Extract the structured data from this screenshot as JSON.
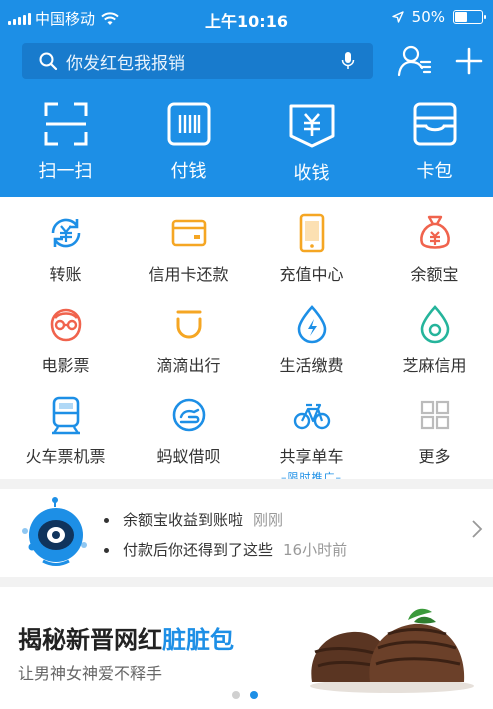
{
  "status_bar": {
    "carrier": "中国移动",
    "time": "上午10:16",
    "battery_text": "50%",
    "battery_level": 0.5
  },
  "search": {
    "placeholder": "你发红包我报销"
  },
  "header_icons": [
    "contacts-icon",
    "plus-icon"
  ],
  "quick_actions": [
    {
      "label": "扫一扫",
      "icon": "scan-icon"
    },
    {
      "label": "付钱",
      "icon": "barcode-icon"
    },
    {
      "label": "收钱",
      "icon": "receive-icon"
    },
    {
      "label": "卡包",
      "icon": "card-wallet-icon"
    }
  ],
  "services": [
    {
      "label": "转账",
      "icon": "transfer-icon",
      "color": "#1d8fe6"
    },
    {
      "label": "信用卡还款",
      "icon": "credit-card-icon",
      "color": "#f5a623"
    },
    {
      "label": "充值中心",
      "icon": "phone-topup-icon",
      "color": "#f5a623"
    },
    {
      "label": "余额宝",
      "icon": "money-bag-icon",
      "color": "#f0634d"
    },
    {
      "label": "电影票",
      "icon": "movie-icon",
      "color": "#f0634d"
    },
    {
      "label": "滴滴出行",
      "icon": "didi-icon",
      "color": "#f5a623"
    },
    {
      "label": "生活缴费",
      "icon": "utility-icon",
      "color": "#1d8fe6"
    },
    {
      "label": "芝麻信用",
      "icon": "sesame-credit-icon",
      "color": "#25b49b"
    },
    {
      "label": "火车票机票",
      "icon": "train-icon",
      "color": "#1d8fe6"
    },
    {
      "label": "蚂蚁借呗",
      "icon": "ant-loan-icon",
      "color": "#1d8fe6"
    },
    {
      "label": "共享单车",
      "icon": "bike-icon",
      "color": "#1d8fe6",
      "promo": "限时推广"
    },
    {
      "label": "更多",
      "icon": "more-grid-icon",
      "color": "#bbbbbb"
    }
  ],
  "notifications": [
    {
      "text": "余额宝收益到账啦",
      "time": "刚刚"
    },
    {
      "text": "付款后你还得到了这些",
      "time": "16小时前"
    }
  ],
  "banner": {
    "title_main": "揭秘新晋网红",
    "title_highlight": "脏脏包",
    "subtitle": "让男神女神爱不释手",
    "page_count": 2,
    "active_page": 2
  },
  "colors": {
    "brand_blue": "#1d8fe6",
    "search_bg": "#187bcd"
  }
}
